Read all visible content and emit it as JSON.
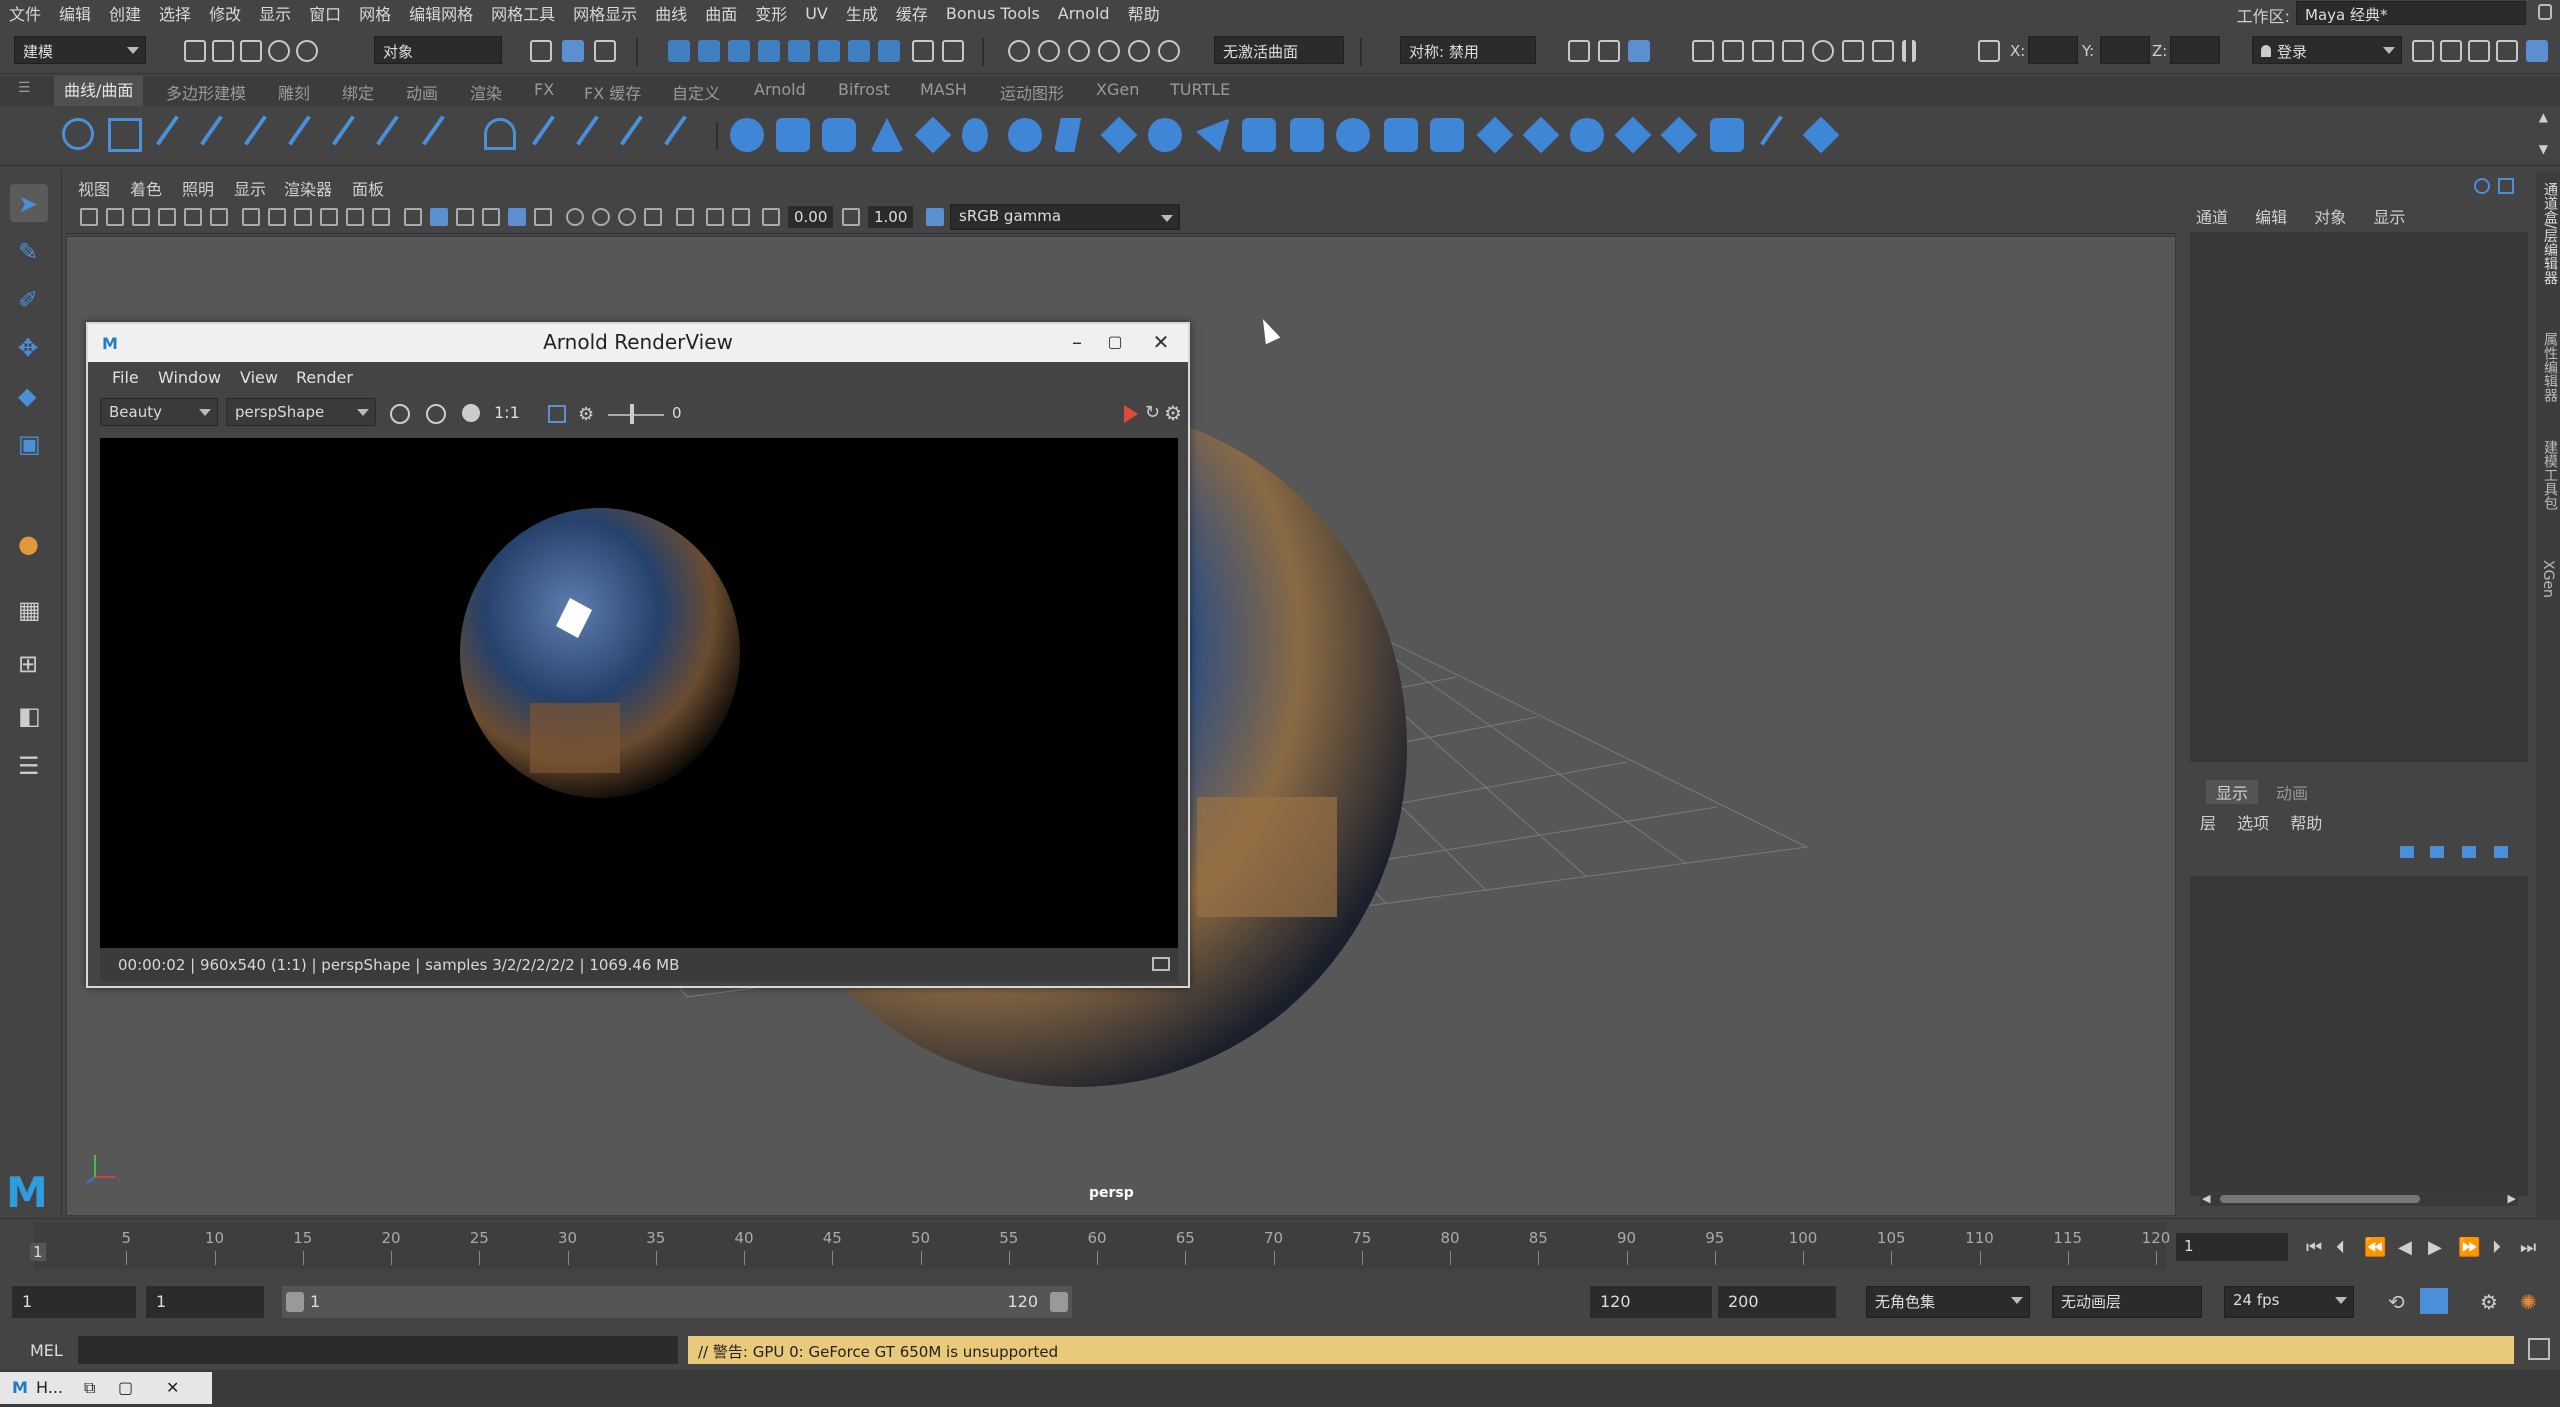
{
  "menubar": {
    "items": [
      "文件",
      "编辑",
      "创建",
      "选择",
      "修改",
      "显示",
      "窗口",
      "网格",
      "编辑网格",
      "网格工具",
      "网格显示",
      "曲线",
      "曲面",
      "变形",
      "UV",
      "生成",
      "缓存",
      "Bonus Tools",
      "Arnold",
      "帮助"
    ],
    "workspace_label": "工作区:",
    "workspace_value": "Maya 经典*"
  },
  "statusline": {
    "mode": "建模",
    "object_label": "对象",
    "live_surface": "无激活曲面",
    "symmetry": "对称: 禁用",
    "x_label": "X:",
    "y_label": "Y:",
    "z_label": "Z:",
    "login": "登录"
  },
  "shelf": {
    "tabs": [
      "曲线/曲面",
      "多边形建模",
      "雕刻",
      "绑定",
      "动画",
      "渲染",
      "FX",
      "FX 缓存",
      "自定义",
      "Arnold",
      "Bifrost",
      "MASH",
      "运动图形",
      "XGen",
      "TURTLE"
    ]
  },
  "viewport": {
    "menus": [
      "视图",
      "着色",
      "照明",
      "显示",
      "渲染器",
      "面板"
    ],
    "gamma_value": "0.00",
    "exposure_value": "1.00",
    "color_space": "sRGB gamma",
    "camera_label": "persp"
  },
  "arnold": {
    "title": "Arnold RenderView",
    "menus": [
      "File",
      "Window",
      "View",
      "Render"
    ],
    "aov": "Beauty",
    "camera": "perspShape",
    "zoom_label": "1:1",
    "exposure_value": "0",
    "status": "00:00:02 | 960x540 (1:1) | perspShape  | samples 3/2/2/2/2/2 | 1069.46 MB"
  },
  "channel_box": {
    "menus": [
      "通道",
      "编辑",
      "对象",
      "显示"
    ],
    "layer_tabs": [
      "显示",
      "动画"
    ],
    "layer_menus": [
      "层",
      "选项",
      "帮助"
    ],
    "side_tabs": [
      "通道盒/层编辑器",
      "属性编辑器",
      "建模工具包",
      "XGen"
    ]
  },
  "timeslider": {
    "ticks": [
      "5",
      "10",
      "15",
      "20",
      "25",
      "30",
      "35",
      "40",
      "45",
      "50",
      "55",
      "60",
      "65",
      "70",
      "75",
      "80",
      "85",
      "90",
      "95",
      "100",
      "105",
      "110",
      "115",
      "120"
    ],
    "start_marker": "1",
    "current_frame": "1"
  },
  "rangeslider": {
    "start": "1",
    "playback_start": "1",
    "bar_start": "1",
    "bar_end": "120",
    "playback_end": "120",
    "end": "200",
    "character_set": "无角色集",
    "anim_layer": "无动画层",
    "fps": "24 fps"
  },
  "cmdline": {
    "mel_label": "MEL",
    "warning": "// 警告:  GPU 0: GeForce GT 650M is unsupported"
  },
  "taskbar": {
    "item_label": "H..."
  },
  "colors": {
    "accent": "#3f87d6",
    "warning_bg": "#e9c97a"
  }
}
